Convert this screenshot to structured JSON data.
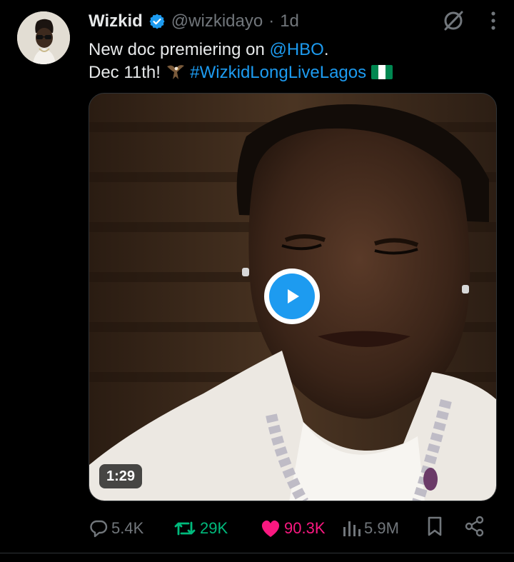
{
  "tweet": {
    "author_name": "Wizkid",
    "handle": "@wizkidayo",
    "separator": "·",
    "time": "1d",
    "text_line1_prefix": "New doc premiering on ",
    "text_line1_mention": "@HBO",
    "text_line1_suffix": ".",
    "text_line2_prefix": "Dec 11th! ",
    "text_line2_hashtag": "#WizkidLongLiveLagos",
    "video_duration": "1:29"
  },
  "metrics": {
    "replies": "5.4K",
    "retweets": "29K",
    "likes": "90.3K",
    "views": "5.9M"
  },
  "icons": {
    "verified": "verified-badge-icon",
    "grok": "slash-circle-icon",
    "more": "more-vertical-icon",
    "reply": "reply-icon",
    "retweet": "retweet-icon",
    "like": "heart-icon",
    "views": "views-icon",
    "bookmark": "bookmark-icon",
    "share": "share-icon"
  },
  "colors": {
    "background": "#000000",
    "text": "#e7e9ea",
    "muted": "#71767b",
    "link": "#1d9bf0",
    "retweet": "#00ba7c",
    "like": "#f91880"
  }
}
